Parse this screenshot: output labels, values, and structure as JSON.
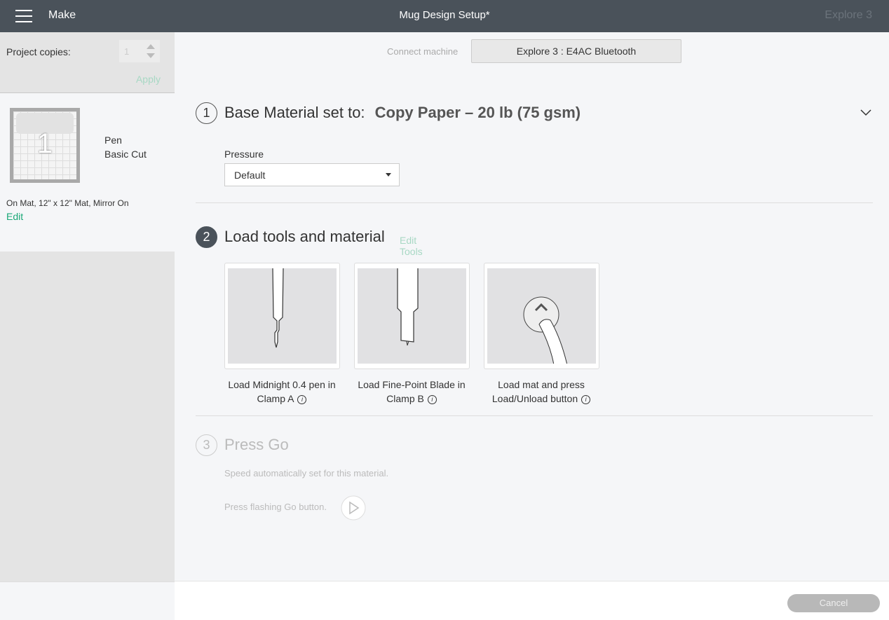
{
  "header": {
    "menu_icon": "hamburger-icon",
    "mode": "Make",
    "title": "Mug Design Setup*",
    "machine": "Explore 3"
  },
  "sidebar": {
    "copies_label": "Project copies:",
    "copies_value": "1",
    "apply": "Apply",
    "mat_number": "1",
    "mat_tools": [
      "Pen",
      "Basic Cut"
    ],
    "mat_info": "On Mat, 12\" x 12\" Mat, Mirror On",
    "edit": "Edit"
  },
  "main": {
    "connect_label": "Connect machine",
    "connect_button": "Explore 3 : E4AC Bluetooth",
    "step1": {
      "num": "1",
      "title": "Base Material set to:",
      "material": "Copy Paper – 20 lb (75 gsm)",
      "pressure_label": "Pressure",
      "pressure_value": "Default"
    },
    "step2": {
      "num": "2",
      "title": "Load tools and material",
      "edit_tools": "Edit Tools",
      "cards": [
        {
          "line1": "Load Midnight 0.4 pen in",
          "line2": "Clamp A"
        },
        {
          "line1": "Load Fine-Point Blade in",
          "line2": "Clamp B"
        },
        {
          "line1": "Load mat and press",
          "line2": "Load/Unload button"
        }
      ]
    },
    "step3": {
      "num": "3",
      "title": "Press Go",
      "speed": "Speed automatically set for this material.",
      "press": "Press flashing Go button."
    }
  },
  "footer": {
    "cancel": "Cancel"
  },
  "colors": {
    "header": "#4a525a",
    "accent": "#1aa877"
  }
}
